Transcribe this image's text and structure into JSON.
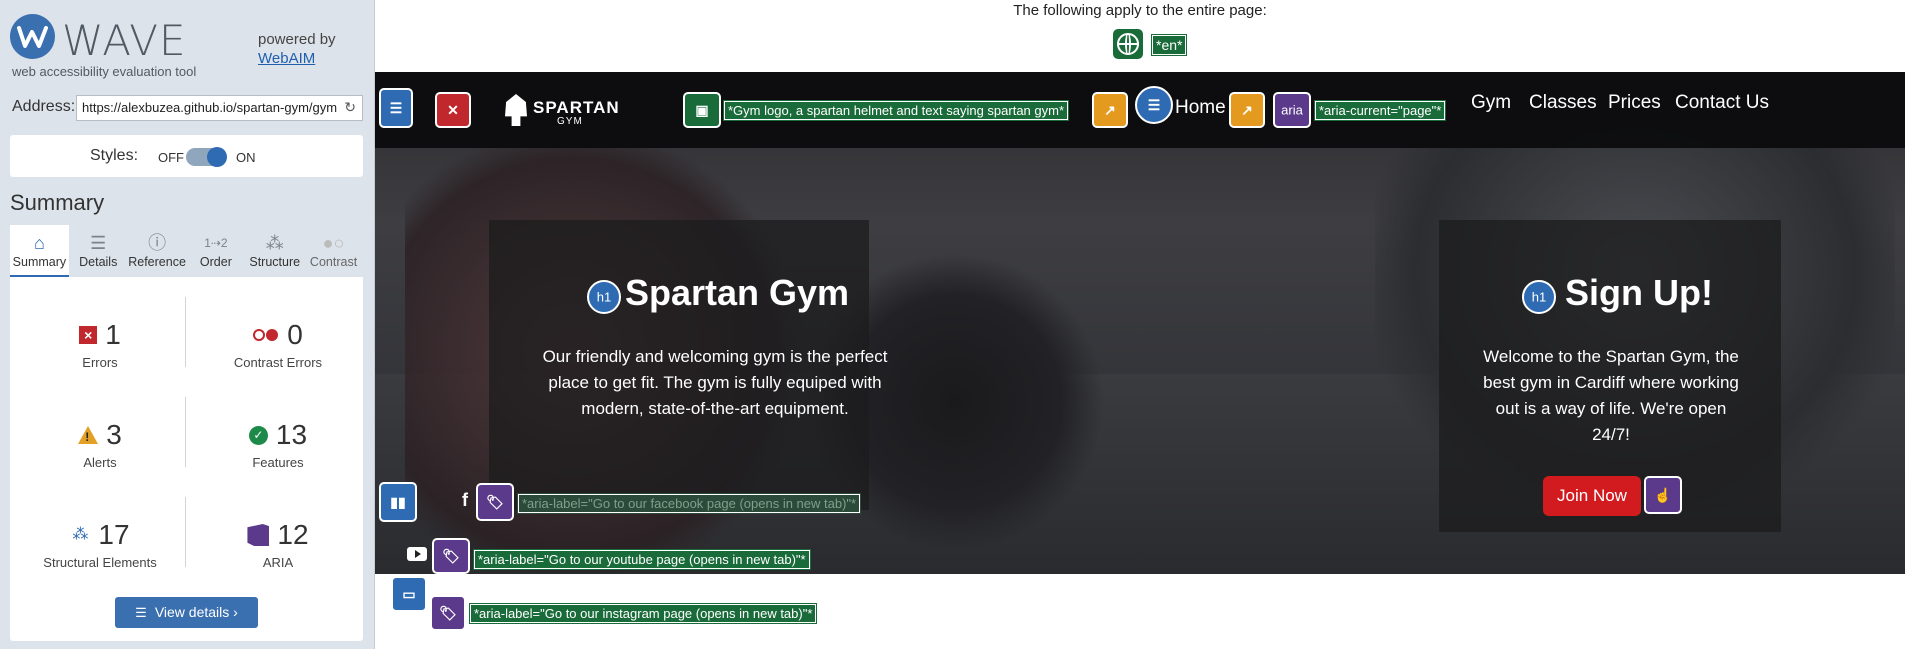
{
  "wave": {
    "logo_text": "WAVE",
    "logo_sub": "web accessibility evaluation tool",
    "powered_by": "powered by",
    "webaim": "WebAIM",
    "address_label": "Address:",
    "address_value": "https://alexbuzea.github.io/spartan-gym/gym",
    "styles_label": "Styles:",
    "styles_off": "OFF",
    "styles_on": "ON",
    "summary_title": "Summary",
    "tabs": [
      {
        "label": "Summary",
        "icon": "home-icon"
      },
      {
        "label": "Details",
        "icon": "list-icon"
      },
      {
        "label": "Reference",
        "icon": "info-icon"
      },
      {
        "label": "Order",
        "icon": "order-icon"
      },
      {
        "label": "Structure",
        "icon": "structure-icon"
      },
      {
        "label": "Contrast",
        "icon": "contrast-icon"
      }
    ],
    "stats": {
      "errors": {
        "value": "1",
        "label": "Errors"
      },
      "contrast": {
        "value": "0",
        "label": "Contrast Errors"
      },
      "alerts": {
        "value": "3",
        "label": "Alerts"
      },
      "features": {
        "value": "13",
        "label": "Features"
      },
      "structural": {
        "value": "17",
        "label": "Structural Elements"
      },
      "aria": {
        "value": "12",
        "label": "ARIA"
      }
    },
    "view_details": "View details ›",
    "colors": {
      "accent": "#3a6fb0",
      "error": "#c0282d",
      "alert": "#e2a024",
      "feature": "#1e8a4a",
      "aria": "#5b3a8c"
    }
  },
  "page": {
    "entire_note": "The following apply to the entire page:",
    "lang_tag": "*en*",
    "logo_alt_tag": "*Gym logo, a spartan helmet and text saying spartan gym*",
    "logo_word": "SPARTAN",
    "logo_sub": "GYM",
    "nav": {
      "home": "Home",
      "aria_badge": "aria",
      "aria_current_tag": "*aria-current=\"page\"*",
      "links": [
        "Gym",
        "Classes",
        "Prices",
        "Contact Us"
      ]
    },
    "hero_left": {
      "h1_badge": "h1",
      "title": "Spartan Gym",
      "text": "Our friendly and welcoming gym is the perfect place to get fit. The gym is fully equiped with modern, state-of-the-art equipment."
    },
    "hero_right": {
      "h1_badge": "h1",
      "title": "Sign Up!",
      "text": "Welcome to the Spartan Gym, the best gym in Cardiff where working out is a way of life. We're open 24/7!",
      "button": "Join Now"
    },
    "social": {
      "facebook_glyph": "f",
      "facebook_tag": "*aria-label=\"Go to our facebook page (opens in new tab)\"*",
      "youtube_tag": "*aria-label=\"Go to our youtube page (opens in new tab)\"*",
      "instagram_tag": "*aria-label=\"Go to our instagram page (opens in new tab)\"*"
    }
  }
}
